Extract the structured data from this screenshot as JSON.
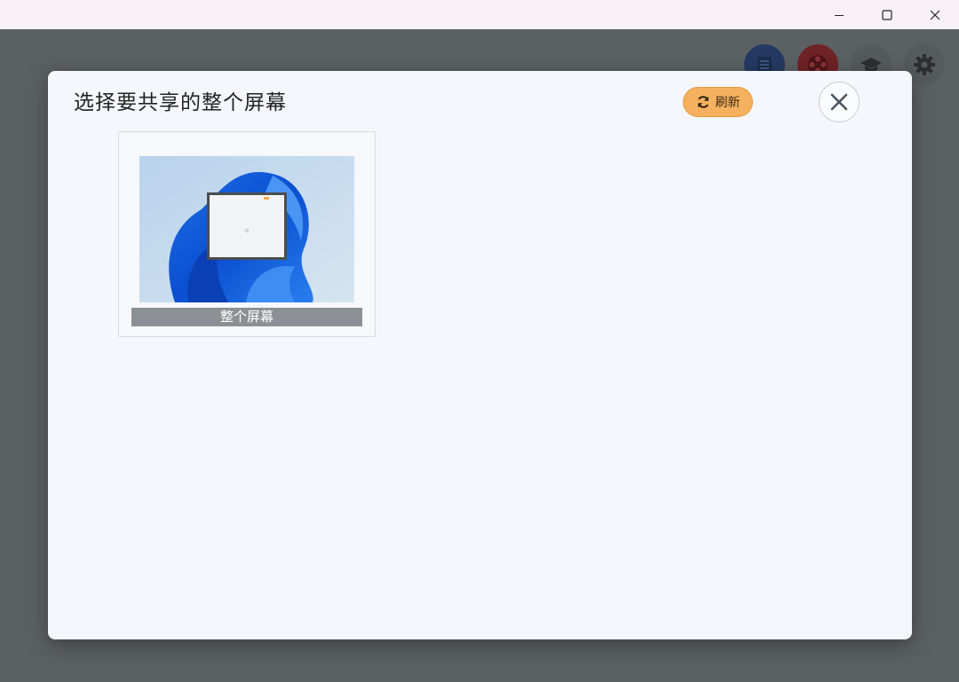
{
  "window": {
    "controls": [
      "minimize-icon",
      "maximize-icon",
      "close-icon"
    ]
  },
  "toolbar": {
    "icons": [
      "document-icon",
      "film-reel-icon",
      "graduation-cap-icon",
      "gear-icon"
    ]
  },
  "dialog": {
    "title": "选择要共享的整个屏幕",
    "refresh_label": "刷新",
    "refresh_color": "#f6b15f",
    "close_icon": "close-icon"
  },
  "screens": [
    {
      "label": "整个屏幕"
    }
  ]
}
